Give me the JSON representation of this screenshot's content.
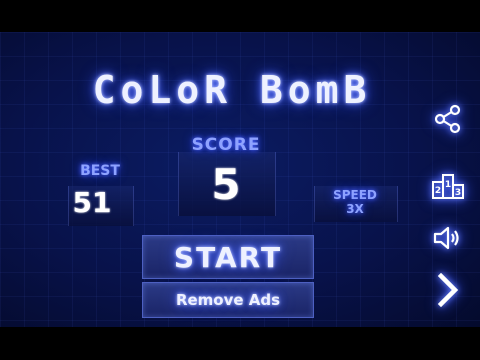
{
  "game": {
    "title": "CoLoR BomB",
    "score": {
      "label": "SCORE",
      "value": "5"
    },
    "best": {
      "label": "BEST",
      "value": "51"
    },
    "speed": {
      "label": "SPEED",
      "value": "3X"
    },
    "buttons": {
      "start": "START",
      "remove_ads": "Remove Ads"
    },
    "side_icons": [
      "share-icon",
      "leaderboard-icon",
      "sound-icon",
      "next-arrow-icon"
    ],
    "leaderboard_digits": [
      "2",
      "1",
      "3"
    ],
    "colors": {
      "background": "#08124a",
      "glow": "#5c74ff",
      "label": "#8ea2ff",
      "button": "#2b3a86"
    }
  }
}
